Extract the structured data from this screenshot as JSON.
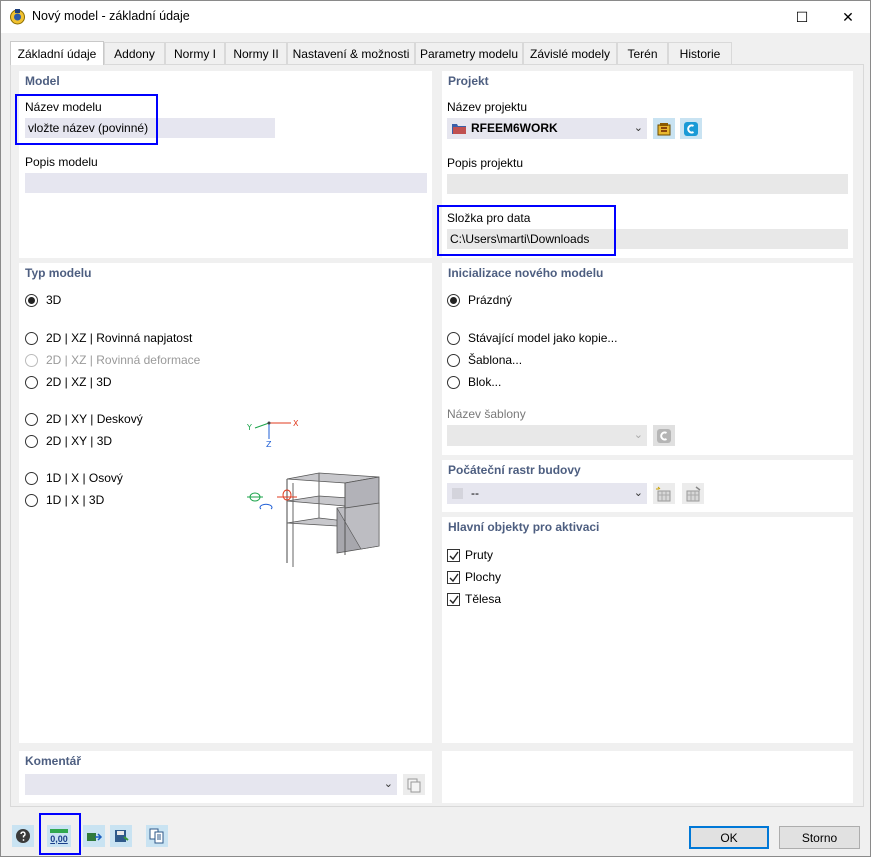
{
  "window": {
    "title": "Nový model - základní údaje",
    "maximize_glyph": "☐",
    "close_glyph": "✕"
  },
  "tabs": [
    {
      "label": "Základní údaje"
    },
    {
      "label": "Addony"
    },
    {
      "label": "Normy I"
    },
    {
      "label": "Normy II"
    },
    {
      "label": "Nastavení & možnosti"
    },
    {
      "label": "Parametry modelu"
    },
    {
      "label": "Závislé modely"
    },
    {
      "label": "Terén"
    },
    {
      "label": "Historie"
    }
  ],
  "model": {
    "title": "Model",
    "name_label": "Název modelu",
    "name_value": "vložte název (povinné)",
    "desc_label": "Popis modelu",
    "desc_value": ""
  },
  "project": {
    "title": "Projekt",
    "name_label": "Název projektu",
    "name_value": "RFEEM6WORK",
    "desc_label": "Popis projektu",
    "desc_value": "",
    "folder_label": "Složka pro data",
    "folder_value": "C:\\Users\\marti\\Downloads"
  },
  "model_type": {
    "title": "Typ modelu",
    "options": [
      {
        "label": "3D",
        "selected": true,
        "disabled": false
      },
      {
        "label": "2D | XZ | Rovinná napjatost",
        "selected": false,
        "disabled": false
      },
      {
        "label": "2D | XZ | Rovinná deformace",
        "selected": false,
        "disabled": true
      },
      {
        "label": "2D | XZ | 3D",
        "selected": false,
        "disabled": false
      },
      {
        "label": "2D | XY | Deskový",
        "selected": false,
        "disabled": false
      },
      {
        "label": "2D | XY | 3D",
        "selected": false,
        "disabled": false
      },
      {
        "label": "1D | X | Osový",
        "selected": false,
        "disabled": false
      },
      {
        "label": "1D | X | 3D",
        "selected": false,
        "disabled": false
      }
    ],
    "axes": {
      "x": "X",
      "y": "Y",
      "z": "Z"
    }
  },
  "init": {
    "title": "Inicializace nového modelu",
    "options": [
      {
        "label": "Prázdný",
        "selected": true
      },
      {
        "label": "Stávající model jako kopie...",
        "selected": false
      },
      {
        "label": "Šablona...",
        "selected": false
      },
      {
        "label": "Blok...",
        "selected": false
      }
    ],
    "template_label": "Název šablony",
    "template_value": ""
  },
  "grid": {
    "title": "Počáteční rastr budovy",
    "value": "--"
  },
  "objects": {
    "title": "Hlavní objekty pro aktivaci",
    "items": [
      {
        "label": "Pruty",
        "checked": true
      },
      {
        "label": "Plochy",
        "checked": true
      },
      {
        "label": "Tělesa",
        "checked": true
      }
    ]
  },
  "comment": {
    "title": "Komentář",
    "value": ""
  },
  "footer": {
    "units_value": "0,00",
    "ok_label": "OK",
    "cancel_label": "Storno"
  },
  "colors": {
    "highlight": "#0000ff",
    "section_title": "#4d5e80",
    "field_bg": "#e6e6f0"
  }
}
